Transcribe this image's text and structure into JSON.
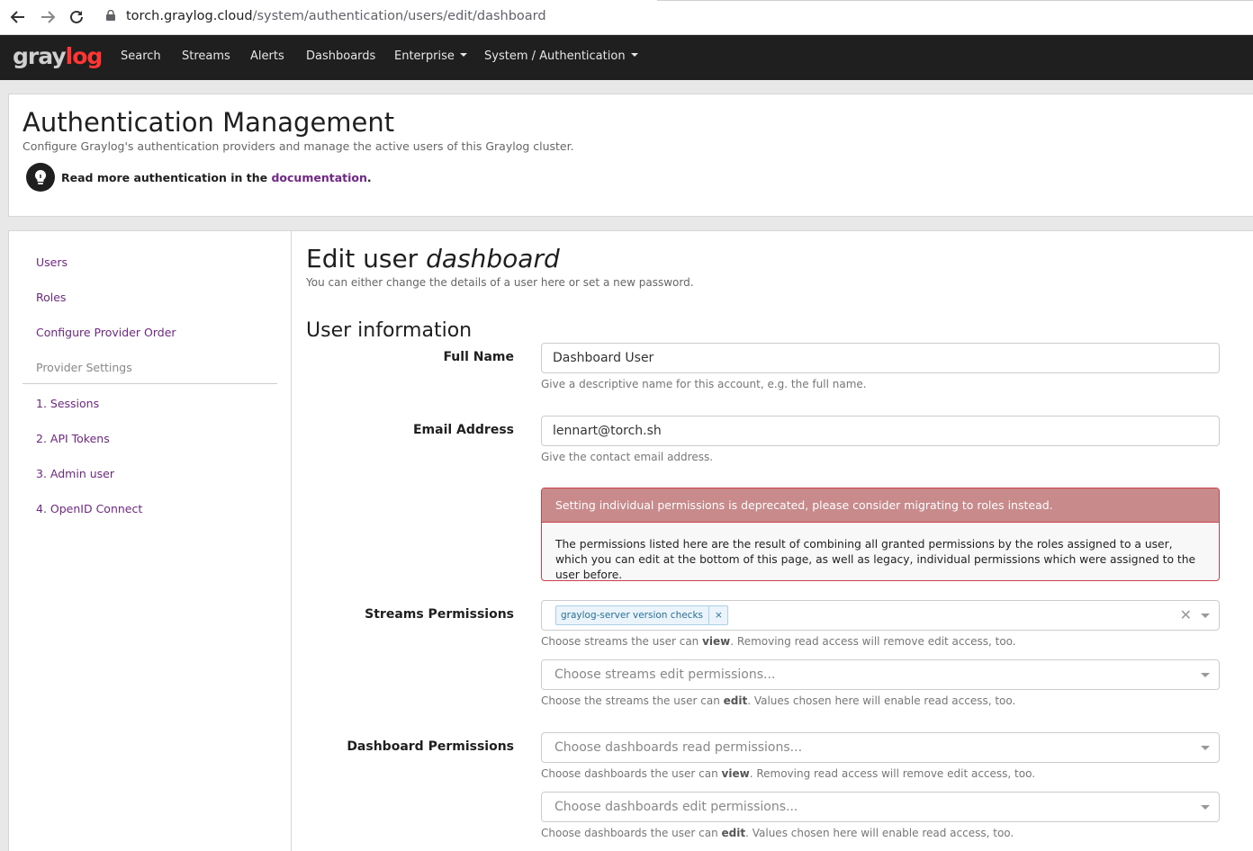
{
  "browser": {
    "url_host": "torch.graylog.cloud",
    "url_path": "/system/authentication/users/edit/dashboard"
  },
  "topnav": {
    "logo_gray": "gray",
    "logo_red": "log",
    "items": [
      "Search",
      "Streams",
      "Alerts",
      "Dashboards",
      "Enterprise",
      "System / Authentication"
    ]
  },
  "header": {
    "title": "Authentication Management",
    "subtitle": "Configure Graylog's authentication providers and manage the active users of this Graylog cluster.",
    "doc_prefix": "Read more authentication in the ",
    "doc_link": "documentation",
    "doc_suffix": "."
  },
  "sidebar": {
    "items": [
      "Users",
      "Roles",
      "Configure Provider Order"
    ],
    "provider_header": "Provider Settings",
    "providers": [
      "1. Sessions",
      "2. API Tokens",
      "3. Admin user",
      "4. OpenID Connect"
    ]
  },
  "content": {
    "title_prefix": "Edit user ",
    "title_user": "dashboard",
    "description": "You can either change the details of a user here or set a new password.",
    "section_title": "User information",
    "full_name": {
      "label": "Full Name",
      "value": "Dashboard User",
      "help": "Give a descriptive name for this account, e.g. the full name."
    },
    "email": {
      "label": "Email Address",
      "value": "lennart@torch.sh",
      "help": "Give the contact email address."
    },
    "alert": {
      "heading": "Setting individual permissions is deprecated, please consider migrating to roles instead.",
      "body": "The permissions listed here are the result of combining all granted permissions by the roles assigned to a user, which you can edit at the bottom of this page, as well as legacy, individual permissions which were assigned to the user before."
    },
    "streams": {
      "label": "Streams Permissions",
      "read_chip": "graylog-server version checks",
      "read_help_pre": "Choose streams the user can ",
      "read_help_bold": "view",
      "read_help_post": ". Removing read access will remove edit access, too.",
      "edit_placeholder": "Choose streams edit permissions...",
      "edit_help_pre": "Choose the streams the user can ",
      "edit_help_bold": "edit",
      "edit_help_post": ". Values chosen here will enable read access, too."
    },
    "dashboards": {
      "label": "Dashboard Permissions",
      "read_placeholder": "Choose dashboards read permissions...",
      "read_help_pre": "Choose dashboards the user can ",
      "read_help_bold": "view",
      "read_help_post": ". Removing read access will remove edit access, too.",
      "edit_placeholder": "Choose dashboards edit permissions...",
      "edit_help_pre": "Choose dashboards the user can ",
      "edit_help_bold": "edit",
      "edit_help_post": ". Values chosen here will enable read access, too."
    }
  }
}
